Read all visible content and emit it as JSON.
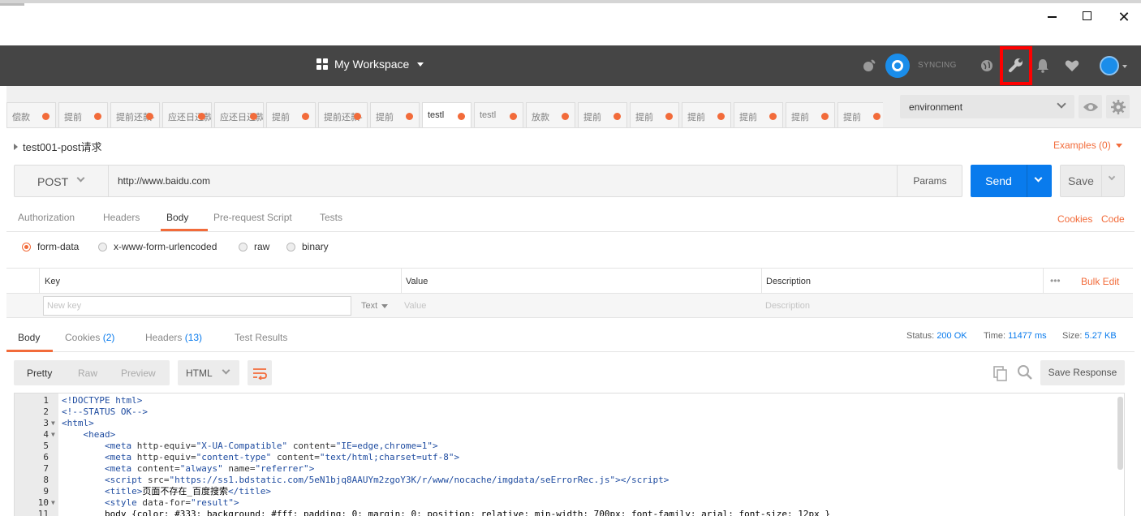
{
  "window": {
    "controls": {
      "minimize": "minimize",
      "maximize": "maximize",
      "close": "close"
    }
  },
  "header": {
    "workspace": "My Workspace",
    "sync_status": "SYNCING",
    "icons": [
      "satellite-icon",
      "sync-icon",
      "globe-icon",
      "wrench-icon",
      "bell-icon",
      "heart-icon",
      "avatar"
    ],
    "highlight_color": "#ff0000"
  },
  "tabs": [
    {
      "label": "偿款",
      "active": false
    },
    {
      "label": "提前",
      "active": false
    },
    {
      "label": "提前还款-",
      "active": false
    },
    {
      "label": "应还日还款",
      "active": false
    },
    {
      "label": "应还日还款",
      "active": false
    },
    {
      "label": "提前",
      "active": false
    },
    {
      "label": "提前还款-",
      "active": false
    },
    {
      "label": "提前",
      "active": false
    },
    {
      "label": "testl",
      "active": true
    },
    {
      "label": "testl",
      "active": false
    },
    {
      "label": "放款",
      "active": false
    },
    {
      "label": "提前",
      "active": false
    },
    {
      "label": "提前",
      "active": false
    },
    {
      "label": "提前",
      "active": false
    },
    {
      "label": "提前",
      "active": false
    },
    {
      "label": "提前",
      "active": false
    },
    {
      "label": "提前",
      "active": false
    }
  ],
  "environment": {
    "selected": "environment"
  },
  "request": {
    "name": "test001-post请求",
    "examples": "Examples (0)",
    "method": "POST",
    "url": "http://www.baidu.com",
    "params_label": "Params",
    "send_label": "Send",
    "save_label": "Save",
    "subtabs": [
      "Authorization",
      "Headers",
      "Body",
      "Pre-request Script",
      "Tests"
    ],
    "active_subtab": "Body",
    "cookies_label": "Cookies",
    "code_label": "Code",
    "body_modes": [
      "form-data",
      "x-www-form-urlencoded",
      "raw",
      "binary"
    ],
    "selected_body_mode": "form-data",
    "table": {
      "columns": [
        "Key",
        "Value",
        "Description"
      ],
      "more": "•••",
      "bulk_edit": "Bulk Edit",
      "key_placeholder": "New key",
      "type": "Text",
      "value_placeholder": "Value",
      "description_placeholder": "Description"
    }
  },
  "response": {
    "tabs": {
      "body": "Body",
      "cookies": "Cookies",
      "cookies_count": "(2)",
      "headers": "Headers",
      "headers_count": "(13)",
      "tests": "Test Results"
    },
    "status_label": "Status:",
    "status": "200 OK",
    "time_label": "Time:",
    "time": "11477 ms",
    "size_label": "Size:",
    "size": "5.27 KB",
    "view_modes": [
      "Pretty",
      "Raw",
      "Preview"
    ],
    "format": "HTML",
    "save_response": "Save Response",
    "code_lines": [
      {
        "n": "1",
        "fold": "",
        "indent": "",
        "html": "<span class='t'>&lt;!DOCTYPE html&gt;</span>"
      },
      {
        "n": "2",
        "fold": "",
        "indent": "",
        "html": "<span class='cm'>&lt;!--STATUS OK--&gt;</span>"
      },
      {
        "n": "3",
        "fold": "▼",
        "indent": "",
        "html": "<span class='t'>&lt;html&gt;</span>"
      },
      {
        "n": "4",
        "fold": "▼",
        "indent": "    ",
        "html": "<span class='t'>&lt;head&gt;</span>"
      },
      {
        "n": "5",
        "fold": "",
        "indent": "        ",
        "html": "<span class='t'>&lt;meta</span> <span class='a'>http-equiv=</span><span class='s'>\"X-UA-Compatible\"</span> <span class='a'>content=</span><span class='s'>\"IE=edge,chrome=1\"</span><span class='t'>&gt;</span>"
      },
      {
        "n": "6",
        "fold": "",
        "indent": "        ",
        "html": "<span class='t'>&lt;meta</span> <span class='a'>http-equiv=</span><span class='s'>\"content-type\"</span> <span class='a'>content=</span><span class='s'>\"text/html;charset=utf-8\"</span><span class='t'>&gt;</span>"
      },
      {
        "n": "7",
        "fold": "",
        "indent": "        ",
        "html": "<span class='t'>&lt;meta</span> <span class='a'>content=</span><span class='s'>\"always\"</span> <span class='a'>name=</span><span class='s'>\"referrer\"</span><span class='t'>&gt;</span>"
      },
      {
        "n": "8",
        "fold": "",
        "indent": "        ",
        "html": "<span class='t'>&lt;script</span> <span class='a'>src=</span><span class='s'>\"https://ss1.bdstatic.com/5eN1bjq8AAUYm2zgoY3K/r/www/nocache/imgdata/seErrorRec.js\"</span><span class='t'>&gt;&lt;/script&gt;</span>"
      },
      {
        "n": "9",
        "fold": "",
        "indent": "        ",
        "html": "<span class='t'>&lt;title&gt;</span><span class='tx'>页面不存在_百度搜索</span><span class='t'>&lt;/title&gt;</span>"
      },
      {
        "n": "10",
        "fold": "▼",
        "indent": "        ",
        "html": "<span class='t'>&lt;style</span> <span class='a'>data-for=</span><span class='s'>\"result\"</span><span class='t'>&gt;</span>"
      },
      {
        "n": "11",
        "fold": "",
        "indent": "        ",
        "html": "<span class='tx'>body {color: #333; background: #fff; padding: 0; margin: 0; position: relative; min-width: 700px; font-family: arial; font-size: 12px }</span>"
      }
    ]
  }
}
